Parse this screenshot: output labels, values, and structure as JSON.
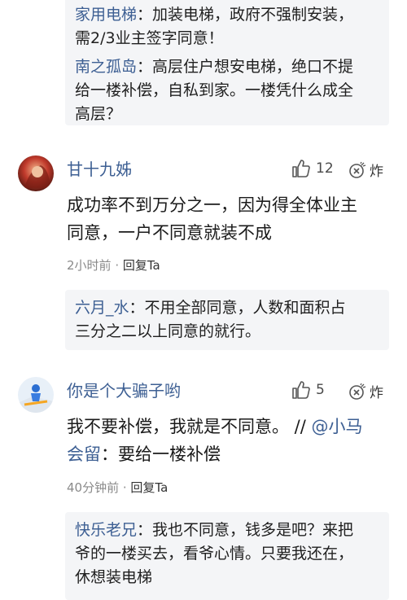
{
  "top_replies": [
    {
      "author": "家用电梯",
      "lines": [
        "：加装电梯，政府不强制安装，",
        "需2/3业主签字同意！"
      ]
    },
    {
      "author": "南之孤岛",
      "lines": [
        "：高层住户想安电梯，绝口不提",
        "给一楼补偿，自私到家。一楼凭什么成全",
        "高层？"
      ]
    }
  ],
  "comments": [
    {
      "username": "甘十九姊",
      "likes": "12",
      "bomb_label": "炸",
      "body_lines": [
        "成功率不到万分之一，因为得全体业主",
        "同意，一户不同意就装不成"
      ],
      "time": "2小时前",
      "separator": " · ",
      "reply_label": "回复Ta",
      "reply": {
        "author": "六月_水",
        "lines": [
          "：不用全部同意，人数和面积占",
          "三分之二以上同意的就行。"
        ]
      }
    },
    {
      "username": "你是个大骗子哟",
      "likes": "5",
      "bomb_label": "炸",
      "body_line1": "我不要补偿，我就是不同意。 //",
      "mention1": "@小马",
      "mention2": "会留",
      "body_line2_rest": "：要给一楼补偿",
      "time": "40分钟前",
      "separator": " · ",
      "reply_label": "回复Ta",
      "reply": {
        "author": "快乐老兄",
        "lines": [
          "：我也不同意，钱多是吧？来把",
          "爷的一楼买去，看爷心情。只要我还在，",
          "休想装电梯"
        ]
      }
    }
  ],
  "icons": {
    "like": "thumbs-up-icon",
    "bomb": "bomb-icon"
  },
  "colors": {
    "link": "#3d5f93",
    "reply_bg": "#f4f5f7",
    "meta": "#8a8a8a"
  }
}
